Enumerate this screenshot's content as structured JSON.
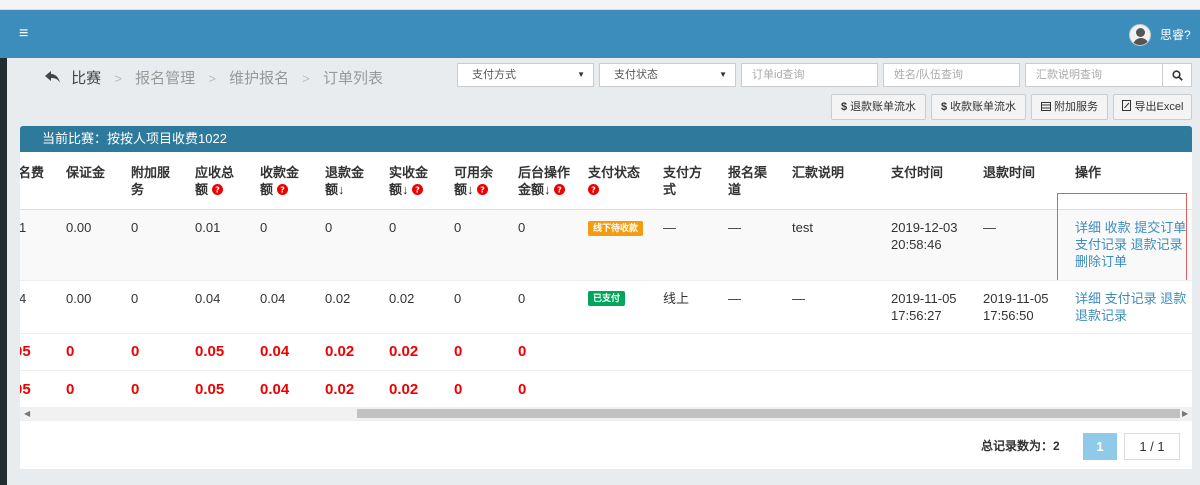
{
  "topbar": {
    "menu_icon": "≡",
    "user_name": "思睿?"
  },
  "breadcrumb": {
    "back_icon": "reply-arrow-icon",
    "home": "比赛",
    "items": [
      "报名管理",
      "维护报名",
      "订单列表"
    ],
    "sep": ">"
  },
  "filters": {
    "pay_method": "支付方式",
    "pay_status": "支付状态",
    "order_id_placeholder": "订单id查询",
    "name_placeholder": "姓名/队伍查询",
    "remit_placeholder": "汇款说明查询",
    "caret": "▼"
  },
  "actions": {
    "refund_flow": "退款账单流水",
    "receive_flow": "收款账单流水",
    "addon_service": "附加服务",
    "export": "导出Excel",
    "dollar": "$"
  },
  "box_title": "当前比赛：按按人项目收费1022",
  "table": {
    "headers": [
      "名费",
      "保证金",
      "附加服务",
      "应收总额",
      "收款金额",
      "退款金额↓",
      "实收金额↓",
      "可用余额↓",
      "后台操作金额↓",
      "支付状态",
      "支付方式",
      "报名渠道",
      "汇款说明",
      "支付时间",
      "退款时间",
      "操作"
    ],
    "header_lines": [
      [
        "名费"
      ],
      [
        "保证金"
      ],
      [
        "附加服",
        "务"
      ],
      [
        "应收总",
        "额"
      ],
      [
        "收款金",
        "额"
      ],
      [
        "退款金",
        "额↓"
      ],
      [
        "实收金",
        "额↓"
      ],
      [
        "可用余",
        "额↓"
      ],
      [
        "后台操作",
        "金额↓"
      ],
      [
        "支付状态",
        ""
      ],
      [
        "支付方",
        "式"
      ],
      [
        "报名渠",
        "道"
      ],
      [
        "汇款说明"
      ],
      [
        "支付时间"
      ],
      [
        "退款时间"
      ],
      [
        "操作"
      ]
    ],
    "rows": [
      {
        "fee": "1",
        "deposit": "0.00",
        "addon": "0",
        "total": "0.01",
        "received": "0",
        "refund": "0",
        "actual": "0",
        "balance": "0",
        "backend": "0",
        "status": "线下待收款",
        "status_color": "#f39c12",
        "method": "—",
        "channel": "—",
        "remark": "test",
        "pay_date": "2019-12-03",
        "pay_time": "20:58:46",
        "refund_date": "—",
        "refund_time": "",
        "ops": [
          "详细",
          "收款",
          "提交订单",
          "支付记录",
          "退款记录",
          "删除订单"
        ]
      },
      {
        "fee": "4",
        "deposit": "0.00",
        "addon": "0",
        "total": "0.04",
        "received": "0.04",
        "refund": "0.02",
        "actual": "0.02",
        "balance": "0",
        "backend": "0",
        "status": "已支付",
        "status_color": "#00a65a",
        "method": "线上",
        "channel": "—",
        "remark": "—",
        "pay_date": "2019-11-05",
        "pay_time": "17:56:27",
        "refund_date": "2019-11-05",
        "refund_time": "17:56:50",
        "ops": [
          "详细",
          "支付记录",
          "退款",
          "退款记录"
        ]
      }
    ],
    "sum_rows": [
      [
        "05",
        "0",
        "0",
        "0.05",
        "0.04",
        "0.02",
        "0.02",
        "0",
        "0"
      ],
      [
        "05",
        "0",
        "0",
        "0.05",
        "0.04",
        "0.02",
        "0.02",
        "0",
        "0"
      ]
    ]
  },
  "pagination": {
    "total_label": "总记录数为：2",
    "current": "1",
    "info": "1 / 1"
  }
}
